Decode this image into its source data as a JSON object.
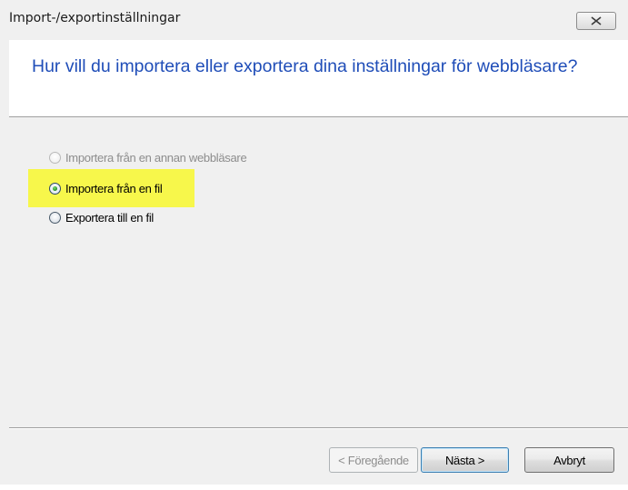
{
  "window": {
    "title": "Import-/exportinställningar",
    "close_icon": "close-x-icon"
  },
  "header": {
    "heading": "Hur vill du importera eller exportera dina inställningar för webbläsare?"
  },
  "options": [
    {
      "label": "Importera från en annan webbläsare",
      "state": "disabled",
      "selected": false
    },
    {
      "label": "Importera från en fil",
      "state": "enabled",
      "selected": true,
      "highlighted": true
    },
    {
      "label": "Exportera till en fil",
      "state": "enabled",
      "selected": false
    }
  ],
  "buttons": {
    "back": "< Föregående",
    "next": "Nästa >",
    "cancel": "Avbryt"
  },
  "colors": {
    "heading": "#1f4db8",
    "highlight": "#f7f74b",
    "background": "#f0f0f0"
  }
}
